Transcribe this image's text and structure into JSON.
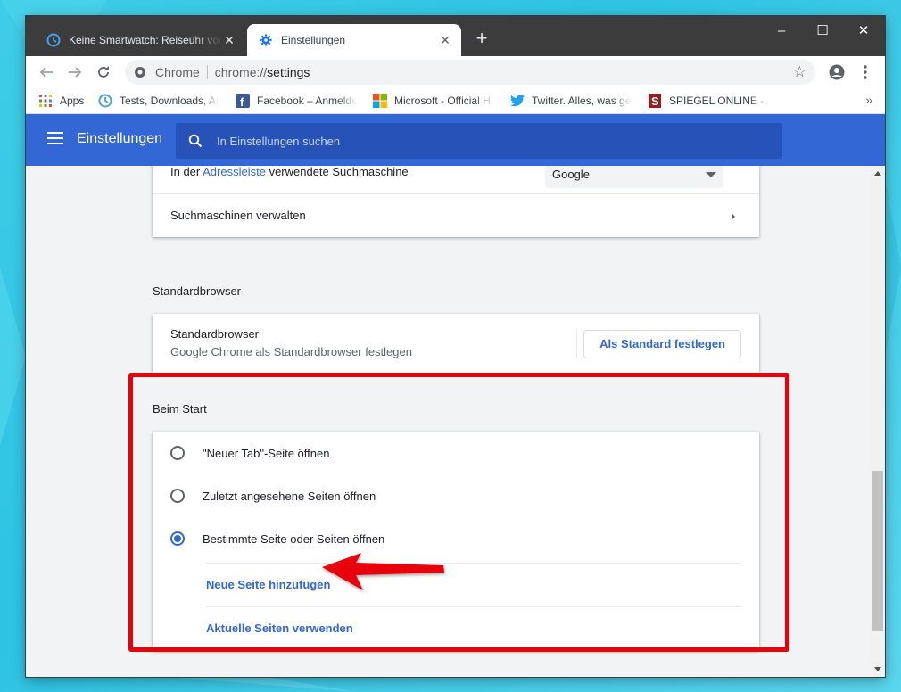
{
  "tabs": [
    {
      "title": "Keine Smartwatch: Reiseuhr von I",
      "icon": "clock-icon",
      "active": false
    },
    {
      "title": "Einstellungen",
      "icon": "gear-icon",
      "active": true
    }
  ],
  "window_controls": {
    "minimize": "–",
    "maximize": "☐",
    "close": "✕"
  },
  "toolbar": {
    "security_label": "Chrome",
    "url_scheme": "chrome://",
    "url_host": "settings"
  },
  "bookmarks": [
    {
      "label": "Apps",
      "icon": "apps-grid-icon"
    },
    {
      "label": "Tests, Downloads, Anl",
      "icon": "clock-icon"
    },
    {
      "label": "Facebook – Anmelden",
      "icon": "facebook-icon"
    },
    {
      "label": "Microsoft - Official H",
      "icon": "microsoft-icon"
    },
    {
      "label": "Twitter. Alles, was ger",
      "icon": "twitter-icon"
    },
    {
      "label": "SPIEGEL ONLINE - Ak",
      "icon": "spiegel-icon"
    }
  ],
  "bookmarks_more": "»",
  "settings_header": {
    "title": "Einstellungen",
    "search_placeholder": "In Einstellungen suchen"
  },
  "search_engine": {
    "label_prefix": "In der ",
    "label_link": "Adressleiste",
    "label_suffix": " verwendete Suchmaschine",
    "selected": "Google",
    "manage_label": "Suchmaschinen verwalten"
  },
  "default_browser": {
    "section_title": "Standardbrowser",
    "row_title": "Standardbrowser",
    "row_subtitle": "Google Chrome als Standardbrowser festlegen",
    "button_label": "Als Standard festlegen"
  },
  "on_startup": {
    "section_title": "Beim Start",
    "options": [
      {
        "label": "\"Neuer Tab\"-Seite öffnen",
        "selected": false
      },
      {
        "label": "Zuletzt angesehene Seiten öffnen",
        "selected": false
      },
      {
        "label": "Bestimmte Seite oder Seiten öffnen",
        "selected": true
      }
    ],
    "add_page_label": "Neue Seite hinzufügen",
    "use_current_label": "Aktuelle Seiten verwenden"
  },
  "colors": {
    "accent": "#3367d6",
    "header": "#3367d6",
    "highlight_border": "#e8000b"
  }
}
